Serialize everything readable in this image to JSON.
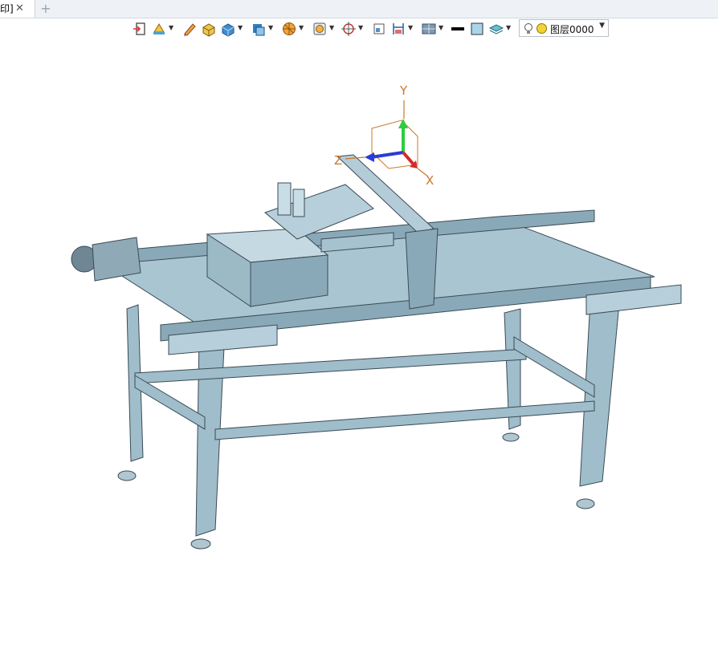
{
  "tabs": {
    "active_label": "印]",
    "close_glyph": "✕",
    "add_glyph": "+"
  },
  "toolbar": {
    "icons": [
      "exit-sketch-icon",
      "paint-icon",
      "pencil-icon",
      "box-feature-icon",
      "solid-view-icon",
      "shaded-view-icon",
      "render-icon",
      "display-icon",
      "snap-icon",
      "frame-icon",
      "dimension-icon",
      "render-mode-icon",
      "line-color-icon",
      "fill-color-icon",
      "layer-icon"
    ],
    "layer": {
      "value": "图层0000"
    }
  },
  "viewport": {
    "axes": {
      "x": "X",
      "y": "Y",
      "z": "Z"
    },
    "model_color": "#a9c5d2"
  }
}
